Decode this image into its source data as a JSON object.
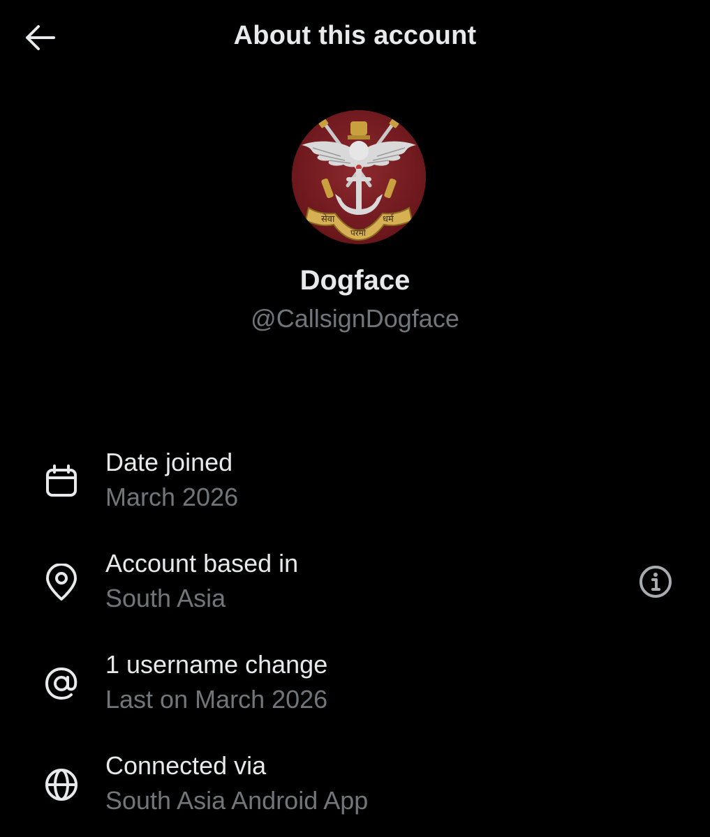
{
  "header": {
    "title": "About this account",
    "back_icon": "arrow-left-icon"
  },
  "profile": {
    "name": "Dogface",
    "handle": "@CallsignDogface",
    "avatar": {
      "icon": "military-emblem-icon",
      "emblem_text_left": "सेवा",
      "emblem_text_center": "परमो",
      "emblem_text_right": "धर्म",
      "background_color": "#7a1d22"
    }
  },
  "details": [
    {
      "id": "date-joined",
      "icon": "calendar-icon",
      "title": "Date joined",
      "subtitle": "March 2026"
    },
    {
      "id": "account-based-in",
      "icon": "location-pin-icon",
      "title": "Account based in",
      "subtitle": "South Asia",
      "action_icon": "info-icon"
    },
    {
      "id": "username-change",
      "icon": "at-sign-icon",
      "title": "1 username change",
      "subtitle": "Last on March 2026"
    },
    {
      "id": "connected-via",
      "icon": "globe-icon",
      "title": "Connected via",
      "subtitle": "South Asia Android App"
    }
  ],
  "colors": {
    "background": "#000000",
    "primary_text": "#e7e9ea",
    "secondary_text": "#71767b"
  }
}
